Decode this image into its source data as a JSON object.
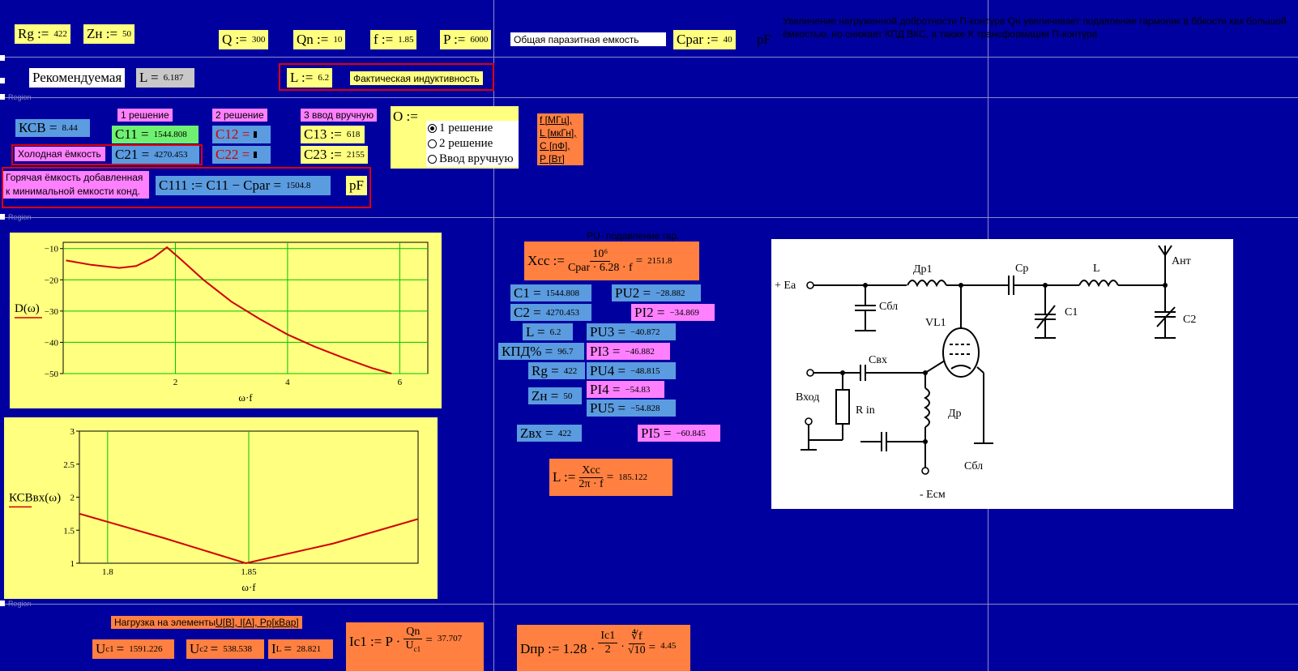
{
  "params": {
    "rg": {
      "label": "Rg :=",
      "value": "422"
    },
    "zn": {
      "label": "Zн :=",
      "value": "50"
    },
    "q": {
      "label": "Q :=",
      "value": "300"
    },
    "qn": {
      "label": "Qn :=",
      "value": "10"
    },
    "f": {
      "label": "f :=",
      "value": "1.85"
    },
    "p": {
      "label": "P :=",
      "value": "6000"
    },
    "cpar_note": "Общая паразитная емкость",
    "cpar": {
      "label": "Cpar :=",
      "value": "40"
    },
    "cpar_unit": "pF"
  },
  "top_note": "Увеличение нагруженной добротности П-контура Qн увеличивает подавление гармоник в ббкосте как большой ёмкостью, но снижает КПД ВКС, а также К трансформации П-контура",
  "recommend": {
    "label": "Рекомендуемая",
    "l_label": "L =",
    "l_value": "6.187",
    "l_set_label": "L :=",
    "l_set_value": "6.2",
    "l_note": "Фактическая индуктивность"
  },
  "region_labels": {
    "r1": "Region",
    "r2": "Region",
    "r3": "Region"
  },
  "solutions": {
    "sol1": "1 решение",
    "sol2": "2 решение",
    "sol3": "3 ввод вручную",
    "ksv_label": "КСВ =",
    "ksv_value": "8.44",
    "c11_label": "C11 =",
    "c11_value": "1544.808",
    "c21_label": "C21 =",
    "c21_value": "4270.453",
    "c12_label": "C12 =",
    "c22_label": "C22 =",
    "c13_label": "C13 :=",
    "c13_value": "618",
    "c23_label": "C23 :=",
    "c23_value": "2155",
    "cold": "Холодная ёмкость",
    "hot_line1": "Горячая ёмкость добавленная",
    "hot_line2": "к минимальной емкости конд.",
    "c111_label": "C111 := C11 − Cpar =",
    "c111_value": "1504.8",
    "c111_unit": "pF"
  },
  "option": {
    "label": "O :=",
    "items": [
      "1 решение",
      "2 решение",
      "Ввод вручную"
    ],
    "selected": 0
  },
  "units_legend": [
    "f [МГц],",
    "L [мкГн],",
    "C [пФ],",
    "P [Вт]"
  ],
  "chart_data": [
    {
      "type": "line",
      "ylabel": "D(ω)",
      "xlabel": "ω·f",
      "xlim": [
        0,
        6.5
      ],
      "ylim": [
        -50,
        -8
      ],
      "xticks": [
        "2",
        "4",
        "6"
      ],
      "yticks": [
        "−10",
        "−20",
        "−30",
        "−40",
        "−50"
      ],
      "grid": true,
      "x": [
        0.05,
        0.5,
        1.0,
        1.3,
        1.6,
        1.85,
        2.1,
        2.5,
        3.0,
        3.5,
        4.0,
        4.5,
        5.0,
        5.5,
        5.85
      ],
      "y": [
        -13.8,
        -15.2,
        -16.2,
        -15.6,
        -13.0,
        -9.6,
        -13.5,
        -20.0,
        -27.0,
        -32.5,
        -37.5,
        -41.5,
        -45.0,
        -48.2,
        -50.0
      ],
      "color": "#d00000"
    },
    {
      "type": "line",
      "ylabel": "КСВвх(ω)",
      "xlabel": "ω·f",
      "xlim": [
        1.79,
        1.91
      ],
      "ylim": [
        1,
        3
      ],
      "xticks": [
        "1.8",
        "1.85"
      ],
      "yticks": [
        "3",
        "2.5",
        "2",
        "1.5",
        "1"
      ],
      "grid": true,
      "x": [
        1.79,
        1.82,
        1.849,
        1.88,
        1.91
      ],
      "y": [
        1.75,
        1.38,
        1.0,
        1.3,
        1.67
      ],
      "color": "#d00000"
    }
  ],
  "calc": {
    "pu_title": "PU- подавление гар.",
    "xcc_label": "Xcc :=",
    "xcc_num": "10⁶",
    "xcc_den": "Cpar · 6.28 · f",
    "xcc_value": "2151.8",
    "c1": {
      "label": "C1 =",
      "value": "1544.808"
    },
    "c2": {
      "label": "C2 =",
      "value": "4270.453"
    },
    "l": {
      "label": "L =",
      "value": "6.2"
    },
    "kpd": {
      "label": "КПД% =",
      "value": "96.7"
    },
    "rg": {
      "label": "Rg =",
      "value": "422"
    },
    "zn": {
      "label": "Zн =",
      "value": "50"
    },
    "pu2": {
      "label": "PU2 =",
      "value": "−28.882"
    },
    "pi2": {
      "label": "PI2 =",
      "value": "−34.869"
    },
    "pu3": {
      "label": "PU3 =",
      "value": "−40.872"
    },
    "pi3": {
      "label": "PI3 =",
      "value": "−46.882"
    },
    "pu4": {
      "label": "PU4 =",
      "value": "−48.815"
    },
    "pi4": {
      "label": "PI4 =",
      "value": "−54.83"
    },
    "pu5": {
      "label": "PU5 =",
      "value": "−54.828"
    },
    "zvx": {
      "label": "Zвх =",
      "value": "422"
    },
    "pi5": {
      "label": "PI5 =",
      "value": "−60.845"
    },
    "l2_label": "L :=",
    "l2_num": "Xcc",
    "l2_den": "2π · f",
    "l2_value": "185.122"
  },
  "loads": {
    "title_prefix": "Нагрузка на элементы ",
    "title_units": "U[В], I[A], Pр[кВар]",
    "uc1": {
      "label": "U",
      "sub": "c1",
      "eq": "=",
      "value": "1591.226"
    },
    "uc2": {
      "label": "U",
      "sub": "c2",
      "eq": "=",
      "value": "538.538"
    },
    "il": {
      "label": "I",
      "sub": "L",
      "eq": "=",
      "value": "28.821"
    },
    "ic1_label": "Ic1 := P ·",
    "ic1_num": "Qn",
    "ic1_den": "U",
    "ic1_den_sub": "c1",
    "ic1_value": "37.707",
    "dnp_label": "Dпр := 1.28 ·",
    "dnp_num": "Ic1",
    "dnp_den": "2",
    "dnp_root_num": "∜f",
    "dnp_root_den": "√10",
    "dnp_value": "4.45"
  },
  "schematic": {
    "ea": "+ Eа",
    "dr1": "Др1",
    "cp": "Ср",
    "l": "L",
    "ant": "Ант",
    "sbl1": "Cбл",
    "c1": "C1",
    "c2": "C2",
    "vl1": "VL1",
    "cvx": "Свх",
    "vhod": "Вход",
    "rin": "R in",
    "dr": "Др",
    "sbl2": "Cбл",
    "esm": "- Eсм"
  }
}
